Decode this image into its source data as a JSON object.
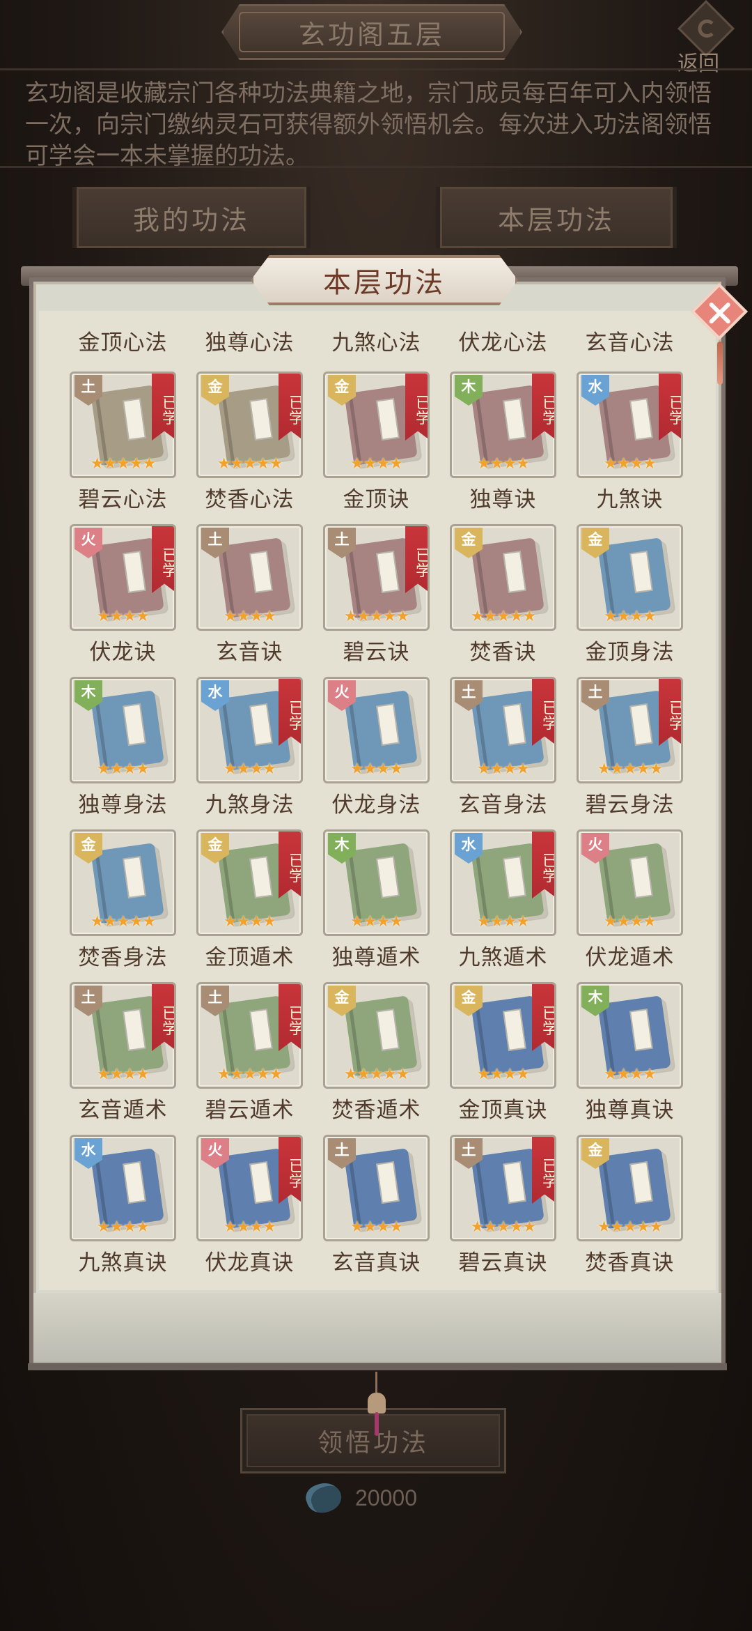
{
  "header": {
    "title": "玄功阁五层",
    "back_label": "返回"
  },
  "description": "玄功阁是收藏宗门各种功法典籍之地，宗门成员每百年可入内领悟一次，向宗门缴纳灵石可获得额外领悟机会。每次进入功法阁领悟可学会一本未掌握的功法。",
  "tabs": {
    "my_skills": "我的功法",
    "floor_skills": "本层功法"
  },
  "panel": {
    "title": "本层功法",
    "top_labels": [
      "金顶心法",
      "独尊心法",
      "九煞心法",
      "伏龙心法",
      "玄音心法"
    ],
    "learned_label": "已学",
    "items": [
      {
        "name": "碧云心法",
        "element": "土",
        "book_color": "gray",
        "stars": 5,
        "learned": true
      },
      {
        "name": "焚香心法",
        "element": "金",
        "book_color": "gray",
        "stars": 5,
        "learned": true
      },
      {
        "name": "金顶诀",
        "element": "金",
        "book_color": "brown",
        "stars": 4,
        "learned": true
      },
      {
        "name": "独尊诀",
        "element": "木",
        "book_color": "brown",
        "stars": 4,
        "learned": true
      },
      {
        "name": "九煞诀",
        "element": "水",
        "book_color": "brown",
        "stars": 4,
        "learned": true
      },
      {
        "name": "伏龙诀",
        "element": "火",
        "book_color": "brown",
        "stars": 4,
        "learned": true
      },
      {
        "name": "玄音诀",
        "element": "土",
        "book_color": "brown",
        "stars": 4,
        "learned": false
      },
      {
        "name": "碧云诀",
        "element": "土",
        "book_color": "brown",
        "stars": 5,
        "learned": true
      },
      {
        "name": "焚香诀",
        "element": "金",
        "book_color": "brown",
        "stars": 5,
        "learned": false
      },
      {
        "name": "金顶身法",
        "element": "金",
        "book_color": "blue",
        "stars": 4,
        "learned": false
      },
      {
        "name": "独尊身法",
        "element": "木",
        "book_color": "blue",
        "stars": 4,
        "learned": false
      },
      {
        "name": "九煞身法",
        "element": "水",
        "book_color": "blue",
        "stars": 4,
        "learned": true
      },
      {
        "name": "伏龙身法",
        "element": "火",
        "book_color": "blue",
        "stars": 4,
        "learned": false
      },
      {
        "name": "玄音身法",
        "element": "土",
        "book_color": "blue",
        "stars": 4,
        "learned": true
      },
      {
        "name": "碧云身法",
        "element": "土",
        "book_color": "blue",
        "stars": 5,
        "learned": true
      },
      {
        "name": "焚香身法",
        "element": "金",
        "book_color": "blue",
        "stars": 5,
        "learned": false
      },
      {
        "name": "金顶遁术",
        "element": "金",
        "book_color": "green",
        "stars": 4,
        "learned": true
      },
      {
        "name": "独尊遁术",
        "element": "木",
        "book_color": "green",
        "stars": 4,
        "learned": false
      },
      {
        "name": "九煞遁术",
        "element": "水",
        "book_color": "green",
        "stars": 4,
        "learned": true
      },
      {
        "name": "伏龙遁术",
        "element": "火",
        "book_color": "green",
        "stars": 4,
        "learned": false
      },
      {
        "name": "玄音遁术",
        "element": "土",
        "book_color": "green",
        "stars": 4,
        "learned": true
      },
      {
        "name": "碧云遁术",
        "element": "土",
        "book_color": "green",
        "stars": 5,
        "learned": true
      },
      {
        "name": "焚香遁术",
        "element": "金",
        "book_color": "green",
        "stars": 5,
        "learned": false
      },
      {
        "name": "金顶真诀",
        "element": "金",
        "book_color": "navy",
        "stars": 4,
        "learned": true
      },
      {
        "name": "独尊真诀",
        "element": "木",
        "book_color": "navy",
        "stars": 4,
        "learned": false
      },
      {
        "name": "九煞真诀",
        "element": "水",
        "book_color": "navy",
        "stars": 4,
        "learned": false
      },
      {
        "name": "伏龙真诀",
        "element": "火",
        "book_color": "navy",
        "stars": 4,
        "learned": true
      },
      {
        "name": "玄音真诀",
        "element": "土",
        "book_color": "navy",
        "stars": 4,
        "learned": false
      },
      {
        "name": "碧云真诀",
        "element": "土",
        "book_color": "navy",
        "stars": 5,
        "learned": true
      },
      {
        "name": "焚香真诀",
        "element": "金",
        "book_color": "navy",
        "stars": 5,
        "learned": false
      }
    ]
  },
  "footer": {
    "comprehend_label": "领悟功法",
    "cost_amount": "20000",
    "cost_icon": "spirit-stone-icon"
  },
  "colors": {
    "element_earth": "#a88c74",
    "element_metal": "#d9b65e",
    "element_wood": "#82b05a",
    "element_water": "#6aa3d3",
    "element_fire": "#dd7f86",
    "learned_ribbon": "#c8353a",
    "star": "#f2a12a"
  }
}
